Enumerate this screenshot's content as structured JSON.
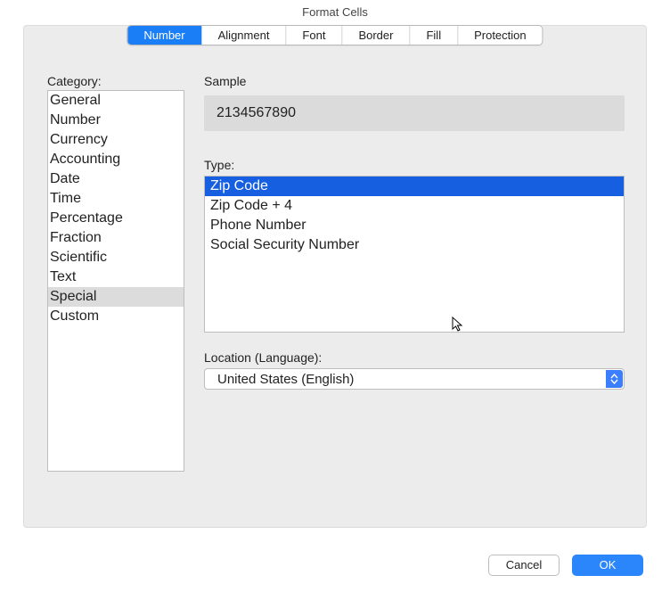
{
  "title": "Format Cells",
  "tabs": [
    {
      "label": "Number",
      "active": true
    },
    {
      "label": "Alignment",
      "active": false
    },
    {
      "label": "Font",
      "active": false
    },
    {
      "label": "Border",
      "active": false
    },
    {
      "label": "Fill",
      "active": false
    },
    {
      "label": "Protection",
      "active": false
    }
  ],
  "labels": {
    "category": "Category:",
    "sample": "Sample",
    "type": "Type:",
    "location": "Location (Language):"
  },
  "categories": [
    "General",
    "Number",
    "Currency",
    "Accounting",
    "Date",
    "Time",
    "Percentage",
    "Fraction",
    "Scientific",
    "Text",
    "Special",
    "Custom"
  ],
  "category_selected_index": 10,
  "sample_value": "2134567890",
  "types": [
    "Zip Code",
    "Zip Code + 4",
    "Phone Number",
    "Social Security Number"
  ],
  "type_selected_index": 0,
  "location_value": "United States (English)",
  "buttons": {
    "cancel": "Cancel",
    "ok": "OK"
  }
}
